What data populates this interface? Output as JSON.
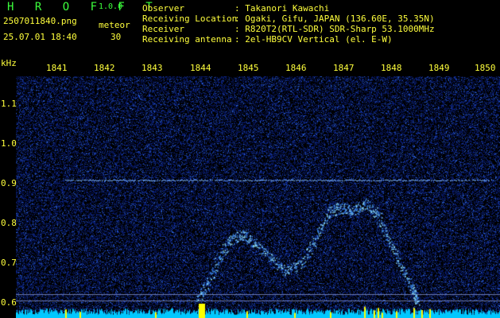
{
  "header": {
    "logo": "H R O F F T",
    "version": "1.0.0",
    "filename": "2507011840.png",
    "meteor_label": "meteor",
    "datetime": "25.07.01 18:40",
    "meteor_count": "30"
  },
  "meta": [
    {
      "key": "Observer",
      "value": ": Takanori Kawachi"
    },
    {
      "key": "Receiving Location",
      "value": ": Ogaki, Gifu, JAPAN (136.60E, 35.35N)"
    },
    {
      "key": "Receiver",
      "value": ": R820T2(RTL-SDR) SDR-Sharp 53.1000MHz"
    },
    {
      "key": "Receiving antenna",
      "value": ": 2el-HB9CV Vertical (el. E-W)"
    }
  ],
  "axes": {
    "y_unit": "kHz",
    "y_ticks": [
      "1.1",
      "1.0",
      "0.9",
      "0.8",
      "0.7",
      "0.6"
    ],
    "x_ticks": [
      "1841",
      "1842",
      "1843",
      "1844",
      "1845",
      "1846",
      "1847",
      "1848",
      "1849",
      "1850"
    ]
  },
  "colors": {
    "background": "#000000",
    "noise_dark": "#0a1a6a",
    "noise_light": "#3a5ad8",
    "signal": "#80d8ff",
    "axis_text": "#ffff3c",
    "title_text": "#3cff3c",
    "bottom_band": "#00c8ff",
    "meteor_marker": "#ffff00"
  }
}
